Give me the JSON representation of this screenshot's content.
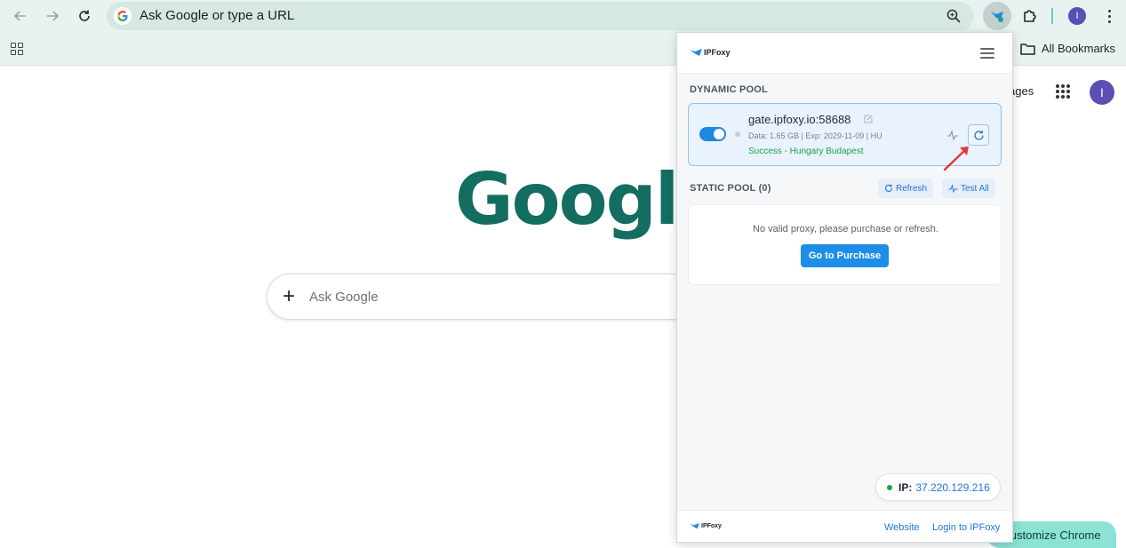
{
  "browser": {
    "omnibox_text": "Ask Google or type a URL",
    "profile_initial": "I",
    "bookmarks_label": "All Bookmarks"
  },
  "ntp": {
    "logo_text": "Google",
    "search_placeholder": "Ask Google",
    "images_link": "Images",
    "images_link_visible": "ages",
    "avatar_initial": "I",
    "customize_label": "Customize Chrome"
  },
  "extension": {
    "brand": "IPFoxy",
    "dynamic_pool": {
      "title": "DYNAMIC POOL",
      "proxy_host": "gate.ipfoxy.io:58688",
      "meta": "Data: 1.65 GB | Exp: 2029-11-09 | HU",
      "status": "Success - Hungary Budapest",
      "enabled": true
    },
    "static_pool": {
      "title": "STATIC POOL (0)",
      "refresh_label": "Refresh",
      "test_all_label": "Test All",
      "empty_message": "No valid proxy, please purchase or refresh.",
      "purchase_label": "Go to Purchase"
    },
    "ip": {
      "label": "IP:",
      "value": "37.220.129.216"
    },
    "footer": {
      "brand": "IPFoxy",
      "website_label": "Website",
      "login_label": "Login to IPFoxy"
    }
  },
  "colors": {
    "accent": "#1e88e5",
    "success": "#17a34a",
    "link": "#2277d8",
    "google_logo": "#136d61",
    "annotation": "#e53935"
  }
}
